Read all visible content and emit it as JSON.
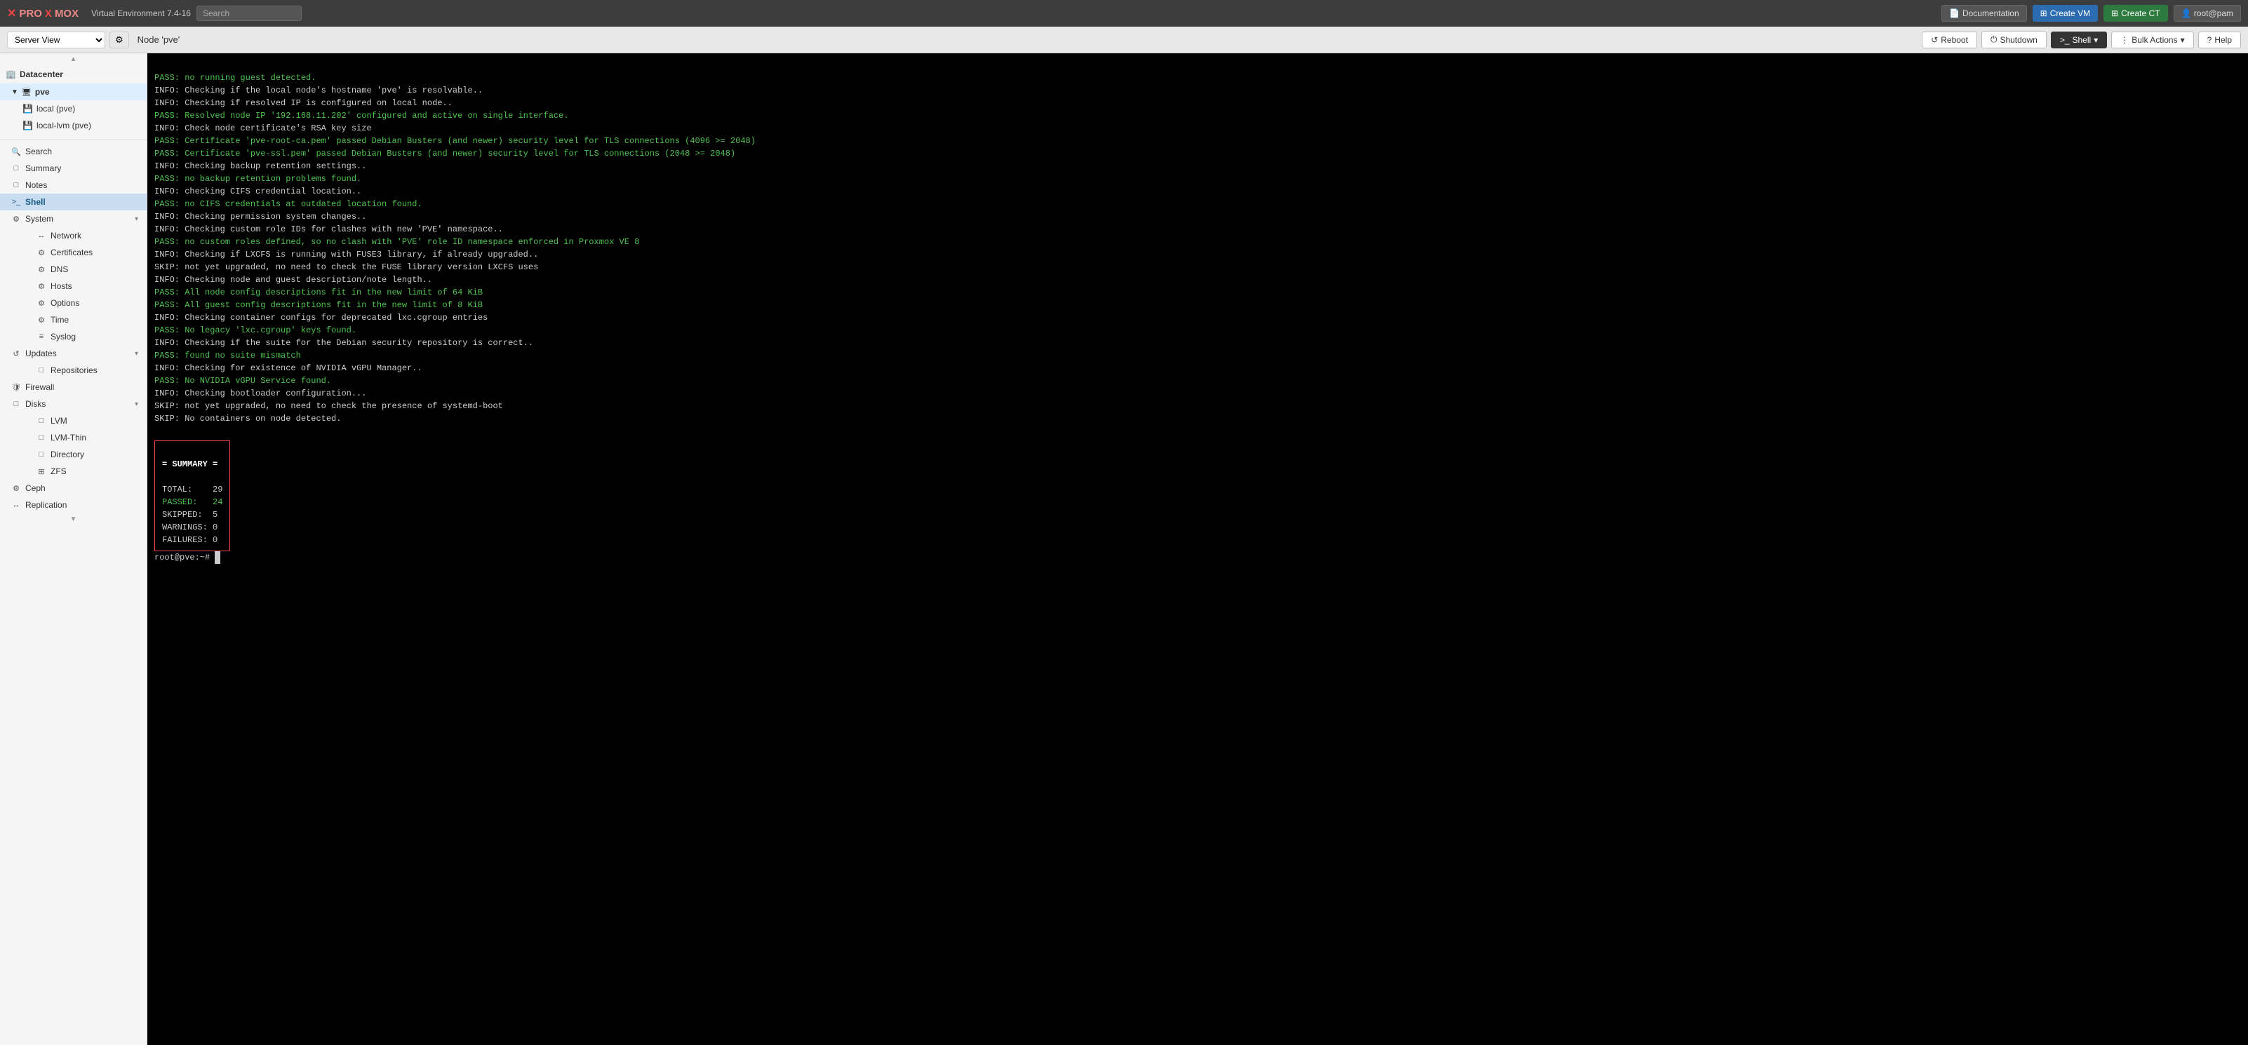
{
  "topbar": {
    "logo": "PROXMOX",
    "env_label": "Virtual Environment 7.4-16",
    "search_placeholder": "Search",
    "doc_btn": "Documentation",
    "create_vm_btn": "Create VM",
    "create_ct_btn": "Create CT",
    "user_btn": "root@pam"
  },
  "secondbar": {
    "server_view_label": "Server View",
    "node_title": "Node 'pve'",
    "reboot_btn": "Reboot",
    "shutdown_btn": "Shutdown",
    "shell_btn": "Shell",
    "bulk_actions_btn": "Bulk Actions",
    "help_btn": "Help"
  },
  "sidebar": {
    "datacenter_label": "Datacenter",
    "pve_label": "pve",
    "storage_local": "local (pve)",
    "storage_lvm": "local-lvm (pve)",
    "scroll_up": "▲",
    "scroll_down": "▼",
    "menu_items": [
      {
        "id": "search",
        "label": "Search",
        "icon": "🔍"
      },
      {
        "id": "summary",
        "label": "Summary",
        "icon": "□"
      },
      {
        "id": "notes",
        "label": "Notes",
        "icon": "□"
      },
      {
        "id": "shell",
        "label": "Shell",
        "icon": ">_",
        "active": true
      },
      {
        "id": "system",
        "label": "System",
        "icon": "⚙",
        "expandable": true
      },
      {
        "id": "network",
        "label": "Network",
        "icon": "↔",
        "indent": true
      },
      {
        "id": "certificates",
        "label": "Certificates",
        "icon": "⚙",
        "indent": true
      },
      {
        "id": "dns",
        "label": "DNS",
        "icon": "⚙",
        "indent": true
      },
      {
        "id": "hosts",
        "label": "Hosts",
        "icon": "⚙",
        "indent": true
      },
      {
        "id": "options",
        "label": "Options",
        "icon": "⚙",
        "indent": true
      },
      {
        "id": "time",
        "label": "Time",
        "icon": "⚙",
        "indent": true
      },
      {
        "id": "syslog",
        "label": "Syslog",
        "icon": "≡",
        "indent": true
      },
      {
        "id": "updates",
        "label": "Updates",
        "icon": "↺",
        "expandable": true
      },
      {
        "id": "repositories",
        "label": "Repositories",
        "icon": "□",
        "indent": true
      },
      {
        "id": "firewall",
        "label": "Firewall",
        "icon": "🛡",
        "expandable": false
      },
      {
        "id": "disks",
        "label": "Disks",
        "icon": "□",
        "expandable": true
      },
      {
        "id": "lvm",
        "label": "LVM",
        "icon": "□",
        "indent": true
      },
      {
        "id": "lvm-thin",
        "label": "LVM-Thin",
        "icon": "□",
        "indent": true
      },
      {
        "id": "directory",
        "label": "Directory",
        "icon": "□",
        "indent": true
      },
      {
        "id": "zfs",
        "label": "ZFS",
        "icon": "⊞",
        "indent": true
      },
      {
        "id": "ceph",
        "label": "Ceph",
        "icon": "⚙",
        "expandable": false
      },
      {
        "id": "replication",
        "label": "Replication",
        "icon": "↔"
      }
    ]
  },
  "terminal": {
    "lines": [
      {
        "type": "pass",
        "text": "PASS: no running guest detected."
      },
      {
        "type": "info",
        "text": "INFO: Checking if the local node's hostname 'pve' is resolvable.."
      },
      {
        "type": "info",
        "text": "INFO: Checking if resolved IP is configured on local node.."
      },
      {
        "type": "pass",
        "text": "PASS: Resolved node IP '192.168.11.202' configured and active on single interface."
      },
      {
        "type": "info",
        "text": "INFO: Check node certificate's RSA key size"
      },
      {
        "type": "pass",
        "text": "PASS: Certificate 'pve-root-ca.pem' passed Debian Busters (and newer) security level for TLS connections (4096 >= 2048)"
      },
      {
        "type": "pass",
        "text": "PASS: Certificate 'pve-ssl.pem' passed Debian Busters (and newer) security level for TLS connections (2048 >= 2048)"
      },
      {
        "type": "info",
        "text": "INFO: Checking backup retention settings.."
      },
      {
        "type": "pass",
        "text": "PASS: no backup retention problems found."
      },
      {
        "type": "info",
        "text": "INFO: checking CIFS credential location.."
      },
      {
        "type": "pass",
        "text": "PASS: no CIFS credentials at outdated location found."
      },
      {
        "type": "info",
        "text": "INFO: Checking permission system changes.."
      },
      {
        "type": "info",
        "text": "INFO: Checking custom role IDs for clashes with new 'PVE' namespace.."
      },
      {
        "type": "pass",
        "text": "PASS: no custom roles defined, so no clash with 'PVE' role ID namespace enforced in Proxmox VE 8"
      },
      {
        "type": "info",
        "text": "INFO: Checking if LXCFS is running with FUSE3 library, if already upgraded.."
      },
      {
        "type": "skip",
        "text": "SKIP: not yet upgraded, no need to check the FUSE library version LXCFS uses"
      },
      {
        "type": "info",
        "text": "INFO: Checking node and guest description/note length.."
      },
      {
        "type": "pass",
        "text": "PASS: All node config descriptions fit in the new limit of 64 KiB"
      },
      {
        "type": "pass",
        "text": "PASS: All guest config descriptions fit in the new limit of 8 KiB"
      },
      {
        "type": "info",
        "text": "INFO: Checking container configs for deprecated lxc.cgroup entries"
      },
      {
        "type": "pass",
        "text": "PASS: No legacy 'lxc.cgroup' keys found."
      },
      {
        "type": "info",
        "text": "INFO: Checking if the suite for the Debian security repository is correct.."
      },
      {
        "type": "pass",
        "text": "PASS: found no suite mismatch"
      },
      {
        "type": "info",
        "text": "INFO: Checking for existence of NVIDIA vGPU Manager.."
      },
      {
        "type": "pass",
        "text": "PASS: No NVIDIA vGPU Service found."
      },
      {
        "type": "info",
        "text": "INFO: Checking bootloader configuration..."
      },
      {
        "type": "skip",
        "text": "SKIP: not yet upgraded, no need to check the presence of systemd-boot"
      },
      {
        "type": "skip",
        "text": "SKIP: No containers on node detected."
      }
    ],
    "summary": {
      "title": "= SUMMARY =",
      "total_label": "TOTAL:",
      "total_val": "29",
      "passed_label": "PASSED:",
      "passed_val": "24",
      "skipped_label": "SKIPPED:",
      "skipped_val": "5",
      "warnings_label": "WARNINGS:",
      "warnings_val": "0",
      "failures_label": "FAILURES:",
      "failures_val": "0"
    },
    "prompt": "root@pve:~#"
  }
}
